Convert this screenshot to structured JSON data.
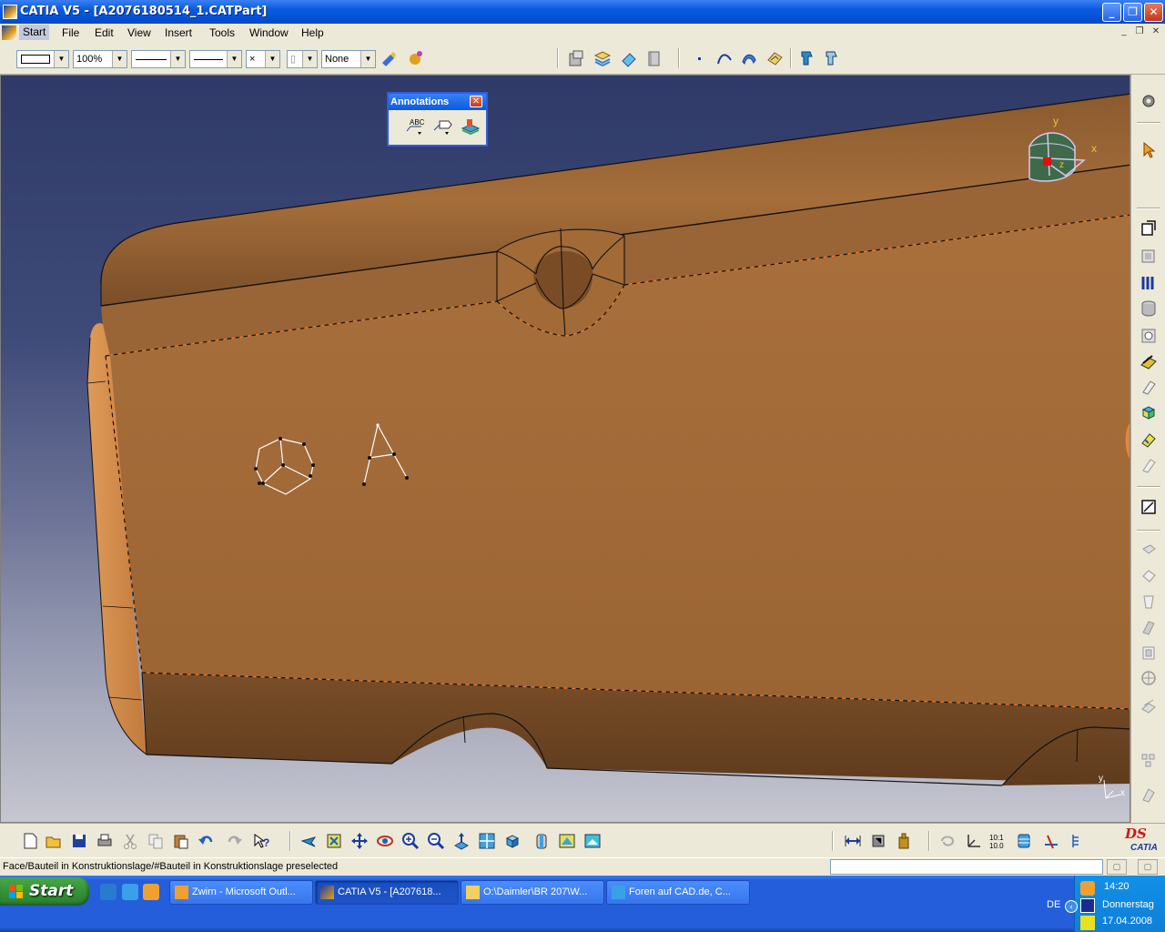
{
  "window": {
    "title": "CATIA V5 - [A2076180514_1.CATPart]",
    "controls": [
      "minimize",
      "restore",
      "close"
    ]
  },
  "menu": {
    "items": [
      "Start",
      "File",
      "Edit",
      "View",
      "Insert",
      "Tools",
      "Window",
      "Help"
    ],
    "active": "Start"
  },
  "toolbar": {
    "zoom_value": "100%",
    "layer_value": "None",
    "point_style_glyph": "×"
  },
  "annotations_toolbar": {
    "title": "Annotations",
    "text_button_label": "ABC"
  },
  "compass": {
    "x_label": "x",
    "y_label": "y",
    "z_label": "z"
  },
  "mini_axis": {
    "x_label": "x",
    "y_label": "y"
  },
  "status": {
    "message": "Face/Bauteil in Konstruktionslage/#Bauteil in Konstruktionslage preselected"
  },
  "taskbar": {
    "start_label": "Start",
    "tasks": [
      {
        "label": "Zwirn - Microsoft Outl...",
        "icon": "outlook-icon",
        "active": false
      },
      {
        "label": "CATIA V5 - [A207618...",
        "icon": "catia-icon",
        "active": true
      },
      {
        "label": "O:\\Daimler\\BR 207\\W...",
        "icon": "folder-icon",
        "active": false
      },
      {
        "label": "Foren auf CAD.de, C...",
        "icon": "ie-icon",
        "active": false
      }
    ],
    "language": "DE",
    "clock": {
      "time": "14:20",
      "day": "Donnerstag",
      "date": "17.04.2008"
    }
  },
  "branding": {
    "logo_text": "CATIA",
    "ds_text": "DS"
  },
  "colors": {
    "part_surface": "#a8713c",
    "part_edge": "#d7894a",
    "dashed_edge": "#e8742a",
    "viewport_top": "#2f3a68",
    "viewport_bottom": "#c5c6cf",
    "xp_blue": "#245edb"
  }
}
